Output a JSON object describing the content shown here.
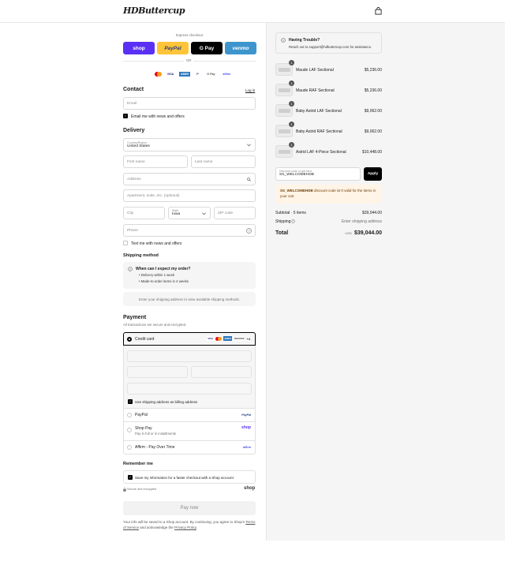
{
  "brand": {
    "logo_text": "HDButtercup"
  },
  "express": {
    "label": "Express checkout",
    "buttons": [
      {
        "label": "shop",
        "color": "#5a31f4",
        "text_color": "#ffffff"
      },
      {
        "label": "PayPal",
        "color": "#ffc439",
        "text_color": "#253b80"
      },
      {
        "label": "G Pay",
        "color": "#000000",
        "text_color": "#ffffff"
      },
      {
        "label": "venmo",
        "color": "#3d95ce",
        "text_color": "#ffffff"
      }
    ],
    "or_label": "OR",
    "card_logos": [
      "VISA",
      "AMEX",
      "P",
      "G Pay",
      "affirm"
    ]
  },
  "contact": {
    "heading": "Contact",
    "login_link": "Log in",
    "email_placeholder": "Email",
    "news_label": "Email me with news and offers",
    "news_checked": true
  },
  "delivery": {
    "heading": "Delivery",
    "country_label": "Country/Region",
    "country_value": "United States",
    "first_name_placeholder": "First name",
    "last_name_placeholder": "Last name",
    "address_placeholder": "Address",
    "apartment_placeholder": "Apartment, suite, etc. (optional)",
    "city_placeholder": "City",
    "state_label": "State",
    "state_value": "Iowa",
    "zip_placeholder": "ZIP code",
    "phone_placeholder": "Phone",
    "sms_label": "Text me with news and offers",
    "sms_checked": false
  },
  "shipping": {
    "heading": "Shipping method",
    "info_title": "When can I expect my order?",
    "info_items": [
      "Delivery within 1 week",
      "Made-to-order items in 4 weeks"
    ],
    "notice": "Enter your shipping address to view available shipping methods."
  },
  "payment": {
    "heading": "Payment",
    "subtitle": "All transactions are secure and encrypted.",
    "credit_label": "Credit card",
    "credit_logos": [
      "VISA",
      "AMEX",
      "DISCOVER"
    ],
    "more_logos": "+4",
    "billing_label": "Use shipping address as billing address",
    "billing_checked": true,
    "options": [
      {
        "label": "PayPal",
        "sublabel": "",
        "logo": "PayPal"
      },
      {
        "label": "Shop Pay",
        "sublabel": "Pay in full or in installments",
        "logo": "shop"
      },
      {
        "label": "Affirm - Pay Over Time",
        "sublabel": "",
        "logo": "affirm"
      }
    ]
  },
  "remember": {
    "heading": "Remember me",
    "save_label": "Save my information for a faster checkout with a Shop account",
    "save_checked": true,
    "secure_label": "Secure and encrypted",
    "shop_logo": "shop"
  },
  "pay_button": "Pay now",
  "legal": {
    "text": "Your info will be saved to a Shop account. By continuing, you agree to Shop's",
    "tos": "Terms of Service",
    "and": "and acknowledge the",
    "privacy": "Privacy Policy",
    "end": "."
  },
  "help": {
    "title": "Having Trouble?",
    "body": "Reach out to support@hdbuttercup.com for assistance."
  },
  "items": [
    {
      "qty": "1",
      "name": "Maude LAF Sectional",
      "price": "$5,236.00"
    },
    {
      "qty": "1",
      "name": "Maude RAF Sectional",
      "price": "$5,236.00"
    },
    {
      "qty": "1",
      "name": "Baby Astrid LAF Sectional",
      "price": "$9,062.00"
    },
    {
      "qty": "1",
      "name": "Baby Astrid RAF Sectional",
      "price": "$9,062.00"
    },
    {
      "qty": "1",
      "name": "Astrid LAF 4-Piece Sectional",
      "price": "$10,448.00"
    }
  ],
  "discount": {
    "label": "Discount code or gift card",
    "value": "SS_WELCOMEHDB",
    "apply_label": "Apply",
    "error_code": "SS_WELCOMEHDB",
    "error_text": "discount code isn't valid for the items in your cart"
  },
  "summary": {
    "subtotal_label": "Subtotal · 5 items",
    "subtotal_value": "$39,044.00",
    "shipping_label": "Shipping",
    "shipping_value": "Enter shipping address",
    "total_label": "Total",
    "currency": "USD",
    "total_value": "$39,044.00"
  }
}
